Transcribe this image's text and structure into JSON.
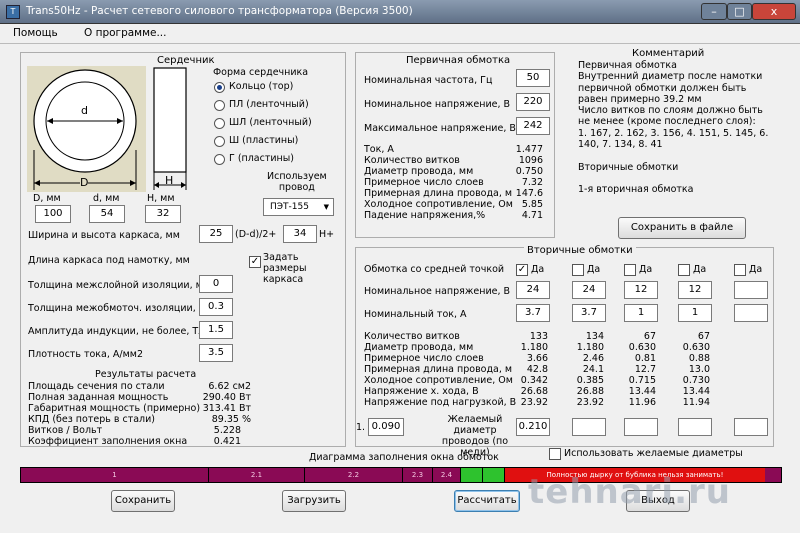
{
  "title": "Trans50Hz - Расчет сетевого силового трансформатора (Версия 3500)",
  "app_icon": "T",
  "winbtns": {
    "minimize": "–",
    "maximize": "□",
    "close": "x"
  },
  "menu": [
    "Помощь",
    "О программе..."
  ],
  "core": {
    "title": "Сердечник",
    "d_inner_label": "d",
    "d_outer_label": "D",
    "h_label": "H",
    "dims": [
      {
        "label": "D, мм",
        "value": "100"
      },
      {
        "label": "d, мм",
        "value": "54"
      },
      {
        "label": "H, мм",
        "value": "32"
      }
    ],
    "shape_title": "Форма сердечника",
    "shapes": [
      "Кольцо  (тор)",
      "ПЛ  (ленточный)",
      "ШЛ  (ленточный)",
      "Ш  (пластины)",
      "Г  (пластины)"
    ],
    "wire_title": "Используем\nпровод",
    "wire": "ПЭТ-155",
    "frame_label": "Ширина и высота каркаса, мм",
    "frame_w": "25",
    "frame_formula": "(D-d)/2+",
    "frame_h": "34",
    "frame_suffix": "H+",
    "frame_len_label": "Длина каркаса под намотку, мм",
    "frame_chk": "Задать размеры каркаса",
    "rows": [
      {
        "label": "Толщина межслойной изоляции, мм",
        "value": "0"
      },
      {
        "label": "Толщина межобмоточ. изоляции, мм",
        "value": "0.3"
      },
      {
        "label": "Амплитуда индукции, не более, Тл",
        "value": "1.5"
      },
      {
        "label": "Плотность тока, А/мм2",
        "value": "3.5"
      }
    ],
    "results_title": "Результаты расчета",
    "results": [
      {
        "label": "Площадь сечения по стали",
        "value": "6.62 см2"
      },
      {
        "label": "Полная заданная мощность",
        "value": "290.40 Вт"
      },
      {
        "label": "Габаритная мощность (примерно)",
        "value": "313.41 Вт"
      },
      {
        "label": "КПД (без потерь в стали)",
        "value": "89.35 %"
      },
      {
        "label": "Витков / Вольт",
        "value": "5.228"
      },
      {
        "label": "Коэффициент заполнения окна",
        "value": "0.421"
      }
    ]
  },
  "primary": {
    "title": "Первичная обмотка",
    "inputs": [
      {
        "label": "Номинальная частота, Гц",
        "value": "50"
      },
      {
        "label": "Номинальное напряжение, В",
        "value": "220"
      },
      {
        "label": "Максимальное напряжение, В",
        "value": "242"
      }
    ],
    "results": [
      {
        "label": "Ток, А",
        "value": "1.477"
      },
      {
        "label": "Количество витков",
        "value": "1096"
      },
      {
        "label": "Диаметр провода, мм",
        "value": "0.750"
      },
      {
        "label": "Примерное число слоев",
        "value": "7.32"
      },
      {
        "label": "Примерная длина провода, м",
        "value": "147.6"
      },
      {
        "label": "Холодное сопротивление, Ом",
        "value": "5.85"
      },
      {
        "label": "Падение напряжения,%",
        "value": "4.71"
      }
    ]
  },
  "comment": {
    "title": "Комментарий",
    "text": "Первичная обмотка\nВнутренний диаметр после намотки первичной обмотки должен быть равен примерно 39.2 мм\nЧисло витков по слоям должно быть не менее (кроме последнего слоя):\n1. 167, 2. 162, 3. 156, 4. 151, 5. 145, 6. 140, 7. 134, 8. 41\n\nВторичные обмотки\n\n1-я вторичная обмотка",
    "save_button": "Сохранить в файле"
  },
  "secondary": {
    "title": "Вторичные обмотки",
    "center_tap_label": "Обмотка со средней точкой",
    "center_tap_opt": "Да",
    "center_tap_checked": [
      true,
      false,
      false,
      false,
      false
    ],
    "voltage_label": "Номинальное напряжение, В",
    "voltages": [
      "24",
      "24",
      "12",
      "12",
      ""
    ],
    "current_label": "Номинальный ток, А",
    "currents": [
      "3.7",
      "3.7",
      "1",
      "1",
      ""
    ],
    "result_labels": [
      "Количество витков",
      "Диаметр провода, мм",
      "Примерное число слоев",
      "Примерная длина провода, м",
      "Холодное сопротивление, Ом",
      "Напряжение х. хода, В",
      "Напряжение под нагрузкой, В"
    ],
    "results": [
      [
        "133",
        "134",
        "67",
        "67"
      ],
      [
        "1.180",
        "1.180",
        "0.630",
        "0.630"
      ],
      [
        "3.66",
        "2.46",
        "0.81",
        "0.88"
      ],
      [
        "42.8",
        "24.1",
        "12.7",
        "13.0"
      ],
      [
        "0.342",
        "0.385",
        "0.715",
        "0.730"
      ],
      [
        "26.68",
        "26.88",
        "13.44",
        "13.44"
      ],
      [
        "23.92",
        "23.92",
        "11.96",
        "11.94"
      ]
    ],
    "desired_index": "1.",
    "desired_val": "0.090",
    "desired_label": "Желаемый диаметр проводов (по меди)",
    "desired_vals": [
      "0.210",
      "",
      "",
      "",
      ""
    ],
    "use_desired": "Использовать желаемые диаметры"
  },
  "diagram": {
    "title": "Диаграмма заполнения окна обмоток",
    "segments": [
      {
        "label": "1",
        "color": "#8a0a55"
      },
      {
        "label": "2.1",
        "color": "#8a0a55"
      },
      {
        "label": "2.2",
        "color": "#8a0a55"
      },
      {
        "label": "2.3",
        "color": "#8a0a55"
      },
      {
        "label": "2.4",
        "color": "#8a0a55"
      },
      {
        "label": "",
        "color": "#2ec22e"
      },
      {
        "label": "",
        "color": "#2ec22e"
      },
      {
        "label": "Полностью дырку от бублика нельзя занимать!",
        "color": "#e01010"
      }
    ]
  },
  "buttons": {
    "save": "Сохранить",
    "load": "Загрузить",
    "calc": "Рассчитать",
    "exit": "Выход"
  },
  "watermark": "tehnari.ru"
}
